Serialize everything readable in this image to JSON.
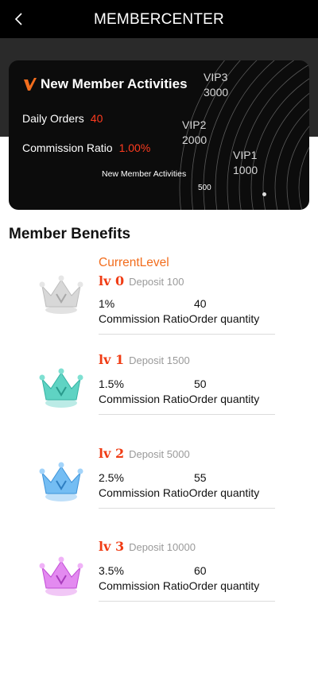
{
  "header": {
    "title": "MEMBERCENTER"
  },
  "card": {
    "title": "New Member Activities",
    "daily_orders_label": "Daily Orders",
    "daily_orders_value": "40",
    "commission_label": "Commission Ratio",
    "commission_value": "1.00%",
    "vip3_name": "VIP3",
    "vip3_value": "3000",
    "vip2_name": "VIP2",
    "vip2_value": "2000",
    "vip1_name": "VIP1",
    "vip1_value": "1000",
    "small_label": "New Member Activities",
    "small_value": "500"
  },
  "benefits": {
    "title": "Member Benefits",
    "current_level": "CurrentLevel",
    "levels": [
      {
        "lv": "lv 0",
        "deposit": "Deposit 100",
        "ratio": "1%",
        "orders": "40",
        "labels": "Commission RatioOrder quantity",
        "color": "#c8c8c8"
      },
      {
        "lv": "lv 1",
        "deposit": "Deposit 1500",
        "ratio": "1.5%",
        "orders": "50",
        "labels": "Commission RatioOrder quantity",
        "color": "#3cc7b6"
      },
      {
        "lv": "lv 2",
        "deposit": "Deposit 5000",
        "ratio": "2.5%",
        "orders": "55",
        "labels": "Commission RatioOrder quantity",
        "color": "#4aa6ee"
      },
      {
        "lv": "lv 3",
        "deposit": "Deposit 10000",
        "ratio": "3.5%",
        "orders": "60",
        "labels": "Commission RatioOrder quantity",
        "color": "#d65ee6"
      }
    ]
  },
  "icons": {
    "back": "chevron-left-icon",
    "brand": "v-logo-icon",
    "crown": "crown-icon"
  },
  "colors": {
    "accent": "#f26d1d",
    "value_red": "#ff3b1f",
    "lv_red": "#f03c14"
  }
}
